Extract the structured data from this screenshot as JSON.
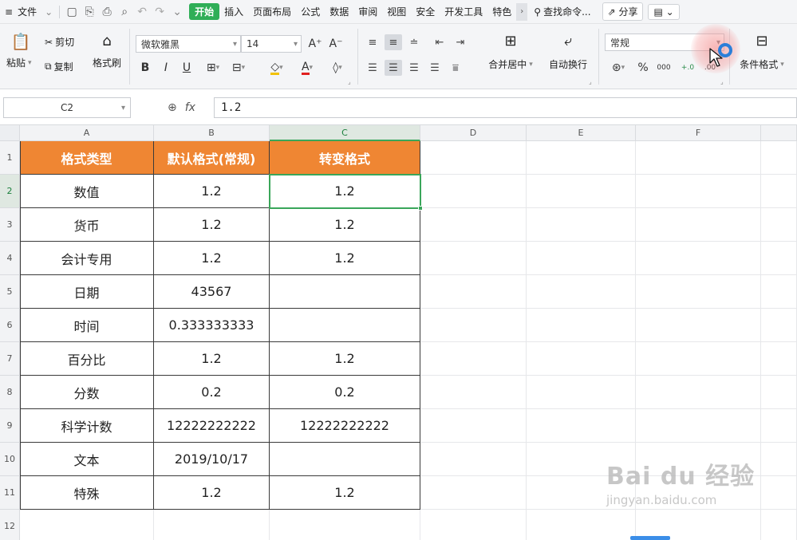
{
  "menubar": {
    "hamburger": "≡",
    "file": "文件",
    "tabs": [
      "开始",
      "插入",
      "页面布局",
      "公式",
      "数据",
      "审阅",
      "视图",
      "安全",
      "开发工具",
      "特色"
    ],
    "active_tab": "开始",
    "search": "查找命令...",
    "share": "分享"
  },
  "ribbon": {
    "paste": "粘贴",
    "cut": "剪切",
    "copy": "复制",
    "format_painter": "格式刷",
    "font_name": "微软雅黑",
    "font_size": "14",
    "grow_font": "A⁺",
    "shrink_font": "A⁻",
    "bold": "B",
    "italic": "I",
    "underline": "U",
    "merge_center": "合并居中",
    "wrap_text": "自动换行",
    "number_format": "常规",
    "percent": "%",
    "thousands": "000",
    "conditional_format": "条件格式"
  },
  "formula_bar": {
    "name_box": "C2",
    "fx_label": "fx",
    "value": "1.2"
  },
  "sheet": {
    "columns": [
      "A",
      "B",
      "C",
      "D",
      "E",
      "F"
    ],
    "rows": [
      "1",
      "2",
      "3",
      "4",
      "5",
      "6",
      "7",
      "8",
      "9",
      "10",
      "11",
      "12"
    ],
    "headers": [
      "格式类型",
      "默认格式(常规)",
      "转变格式"
    ],
    "data": [
      [
        "数值",
        "1.2",
        "1.2"
      ],
      [
        "货币",
        "1.2",
        "1.2"
      ],
      [
        "会计专用",
        "1.2",
        "1.2"
      ],
      [
        "日期",
        "43567",
        ""
      ],
      [
        "时间",
        "0.333333333",
        ""
      ],
      [
        "百分比",
        "1.2",
        "1.2"
      ],
      [
        "分数",
        "0.2",
        "0.2"
      ],
      [
        "科学计数",
        "12222222222",
        "12222222222"
      ],
      [
        "文本",
        "2019/10/17",
        ""
      ],
      [
        "特殊",
        "1.2",
        "1.2"
      ]
    ],
    "selected_cell": "C2"
  },
  "watermark": {
    "brand": "Bai du 经验",
    "url": "jingyan.baidu.com"
  },
  "colors": {
    "header_fill": "#ef8633",
    "selection": "#3aa65a",
    "active_tab": "#2fae57"
  }
}
